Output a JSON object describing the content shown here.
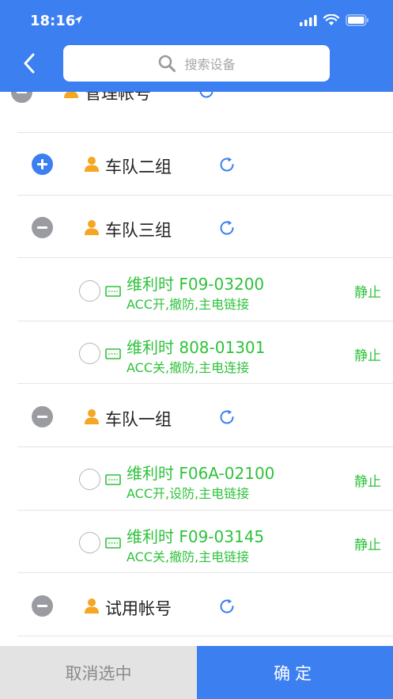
{
  "status_bar": {
    "time": "18:16"
  },
  "search": {
    "placeholder": "搜索设备"
  },
  "groups": [
    {
      "label": "管理帐号",
      "state": "expanded"
    },
    {
      "label": "车队二组",
      "state": "collapsed"
    },
    {
      "label": "车队三组",
      "state": "expanded"
    },
    {
      "label": "车队一组",
      "state": "expanded"
    },
    {
      "label": "试用帐号",
      "state": "expanded"
    }
  ],
  "devices": [
    {
      "name": "维利时 F09-03200",
      "status": "ACC开,撤防,主电链接",
      "state": "静止"
    },
    {
      "name": "维利时 808-01301",
      "status": "ACC关,撤防,主电连接",
      "state": "静止"
    },
    {
      "name": "维利时 F06A-02100",
      "status": "ACC开,设防,主电链接",
      "state": "静止"
    },
    {
      "name": "维利时 F09-03145",
      "status": "ACC关,撤防,主电链接",
      "state": "静止"
    }
  ],
  "footer": {
    "cancel_label": "取消选中",
    "confirm_label": "确定"
  },
  "colors": {
    "accent": "#3b7ff0",
    "online_green": "#2ec23b",
    "icon_orange": "#f5a623",
    "toggle_gray": "#9b9ca1"
  }
}
